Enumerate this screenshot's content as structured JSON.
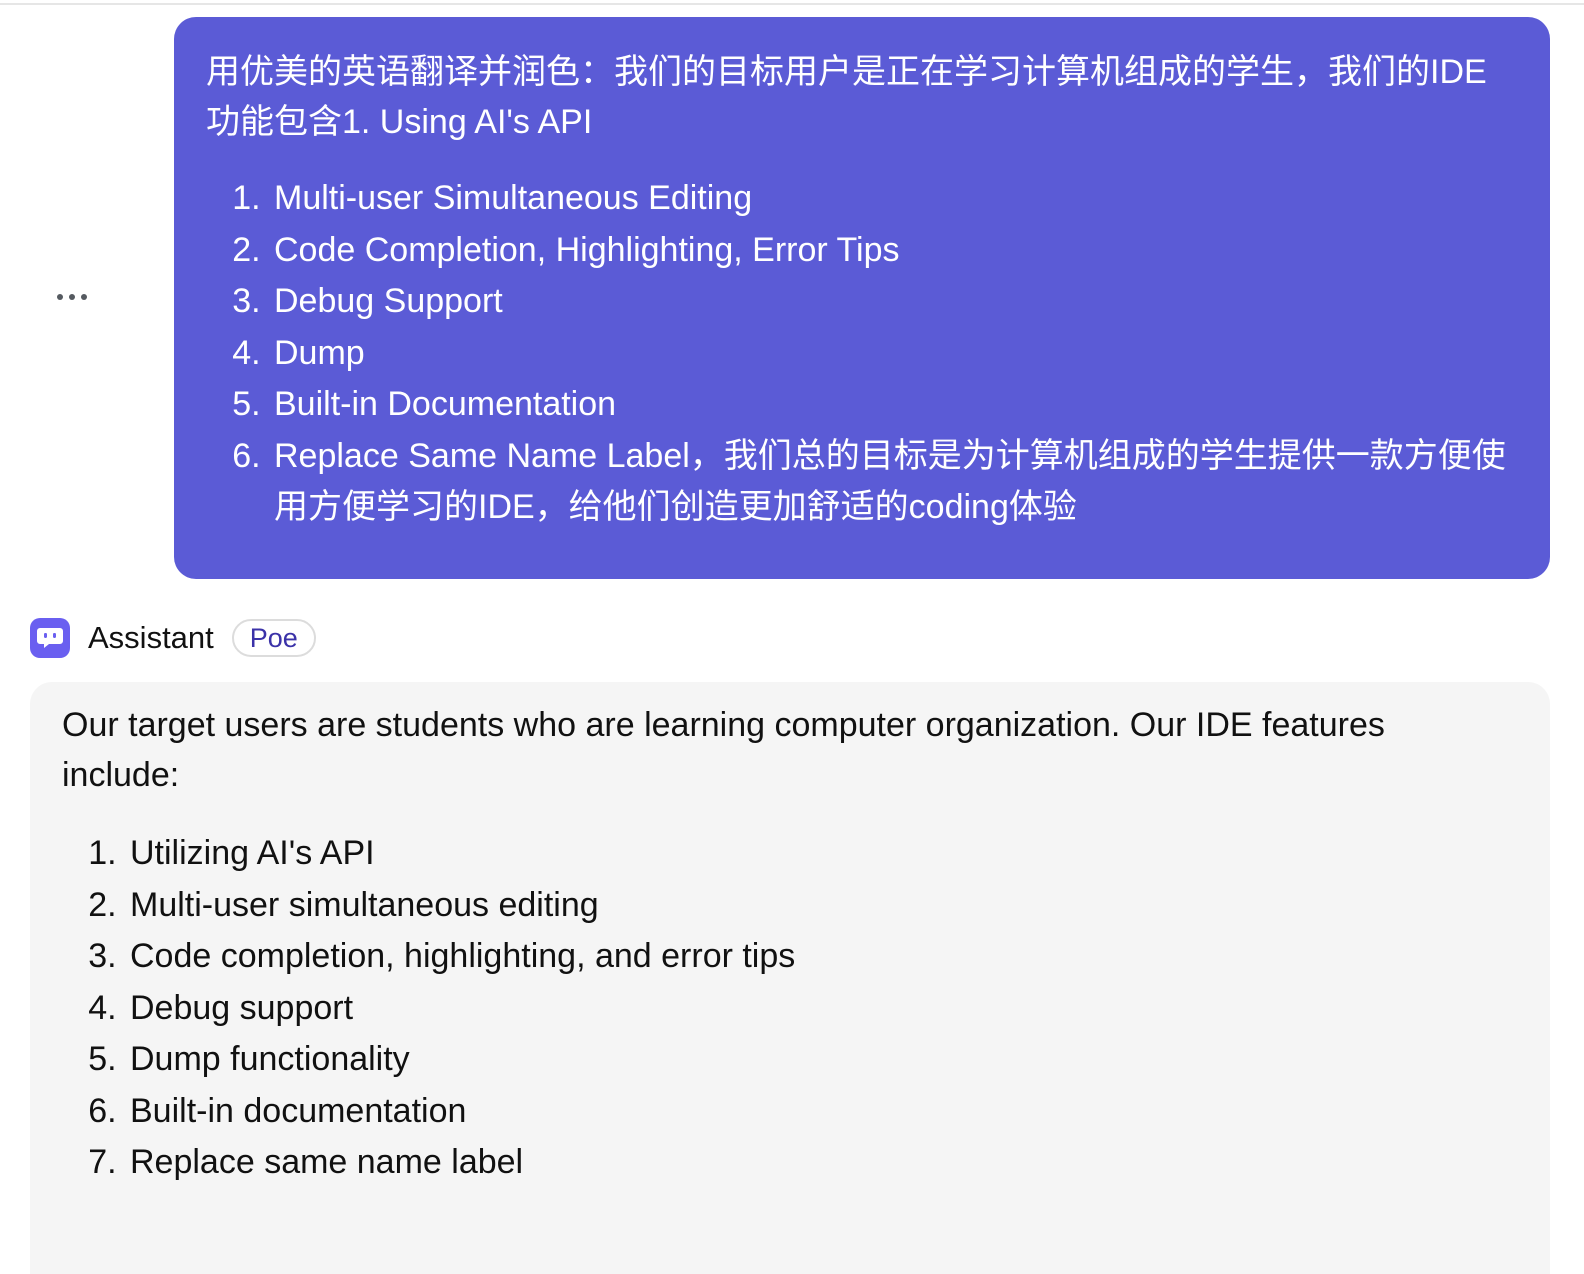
{
  "user_message": {
    "intro": "用优美的英语翻译并润色：我们的目标用户是正在学习计算机组成的学生，我们的IDE功能包含1. Using AI's API",
    "items": [
      "Multi-user Simultaneous Editing",
      "Code Completion, Highlighting, Error Tips",
      "Debug Support",
      "Dump",
      "Built-in Documentation",
      "Replace Same Name Label，我们总的目标是为计算机组成的学生提供一款方便使用方便学习的IDE，给他们创造更加舒适的coding体验"
    ]
  },
  "bot": {
    "avatar_icon": "bot-chat-icon",
    "name": "Assistant",
    "badge": "Poe"
  },
  "bot_message": {
    "intro": "Our target users are students who are learning computer organization. Our IDE features include:",
    "items": [
      "Utilizing AI's API",
      "Multi-user simultaneous editing",
      "Code completion, highlighting, and error tips",
      "Debug support",
      "Dump functionality",
      "Built-in documentation",
      "Replace same name label"
    ]
  },
  "colors": {
    "user_bubble": "#5b5bd6",
    "bot_bubble": "#f5f5f5",
    "avatar": "#6a5ff0",
    "badge_text": "#3b32a8"
  }
}
